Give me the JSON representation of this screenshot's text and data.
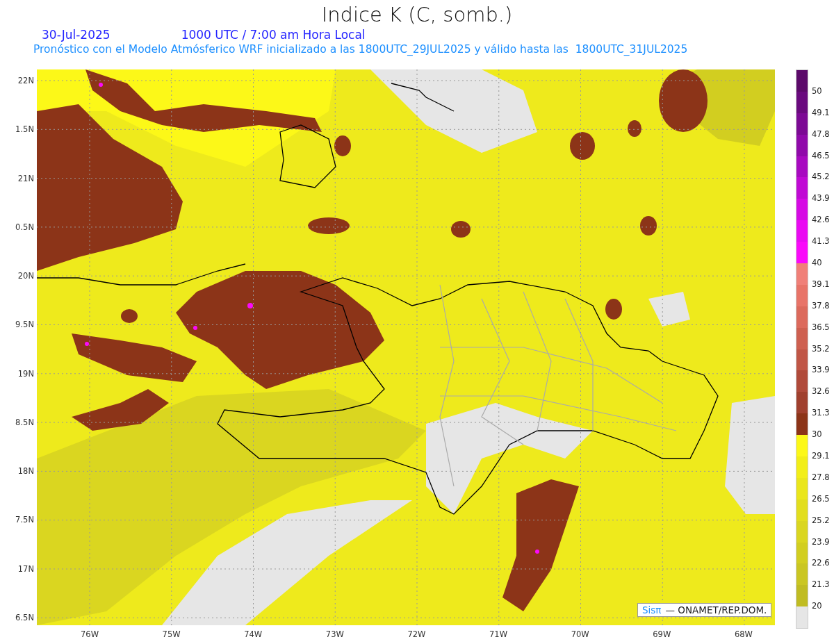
{
  "header": {
    "title": "Indice K (C, somb.)",
    "date": "30-Jul-2025",
    "time": "1000 UTC / 7:00 am Hora Local",
    "subtitle": "Pronóstico con el Modelo Atmósferico WRF inicializado a las 1800UTC_29JUL2025 y válido hasta las  1800UTC_31JUL2025"
  },
  "map": {
    "lat_labels": [
      "22N",
      "1.5N",
      "21N",
      "0.5N",
      "20N",
      "9.5N",
      "19N",
      "8.5N",
      "18N",
      "7.5N",
      "17N",
      "6.5N"
    ],
    "lon_labels": [
      "76W",
      "75W",
      "74W",
      "73W",
      "72W",
      "71W",
      "70W",
      "69W",
      "68W"
    ],
    "credit": {
      "logo": "Sisπ",
      "text": "— ONAMET/REP.DOM."
    }
  },
  "legend": {
    "top_segment": {
      "color": "#5c0a6a"
    },
    "steps": [
      {
        "label": "50",
        "color": "#6a0a7e"
      },
      {
        "label": "49.1",
        "color": "#7c0a94"
      },
      {
        "label": "47.8",
        "color": "#900aaa"
      },
      {
        "label": "46.5",
        "color": "#a80ac0"
      },
      {
        "label": "45.2",
        "color": "#c00ad4"
      },
      {
        "label": "43.9",
        "color": "#d60ae4"
      },
      {
        "label": "42.6",
        "color": "#ea0af2"
      },
      {
        "label": "41.3",
        "color": "#fa0afa"
      },
      {
        "label": "40",
        "color": "#f08078"
      },
      {
        "label": "39.1",
        "color": "#e87468"
      },
      {
        "label": "37.8",
        "color": "#dc6a5c"
      },
      {
        "label": "36.5",
        "color": "#ce6050"
      },
      {
        "label": "35.2",
        "color": "#c05646"
      },
      {
        "label": "33.9",
        "color": "#b04a3a"
      },
      {
        "label": "32.6",
        "color": "#a0402e"
      },
      {
        "label": "31.3",
        "color": "#8c3418"
      },
      {
        "label": "30",
        "color": "#fcf818"
      },
      {
        "label": "29.1",
        "color": "#f2ee18"
      },
      {
        "label": "27.8",
        "color": "#eae61c"
      },
      {
        "label": "26.5",
        "color": "#e2de1e"
      },
      {
        "label": "25.2",
        "color": "#dad620"
      },
      {
        "label": "23.9",
        "color": "#d2ce20"
      },
      {
        "label": "22.6",
        "color": "#cac622"
      },
      {
        "label": "21.3",
        "color": "#c0bc22"
      },
      {
        "label": "20",
        "color": "#e6e6e6"
      }
    ]
  }
}
